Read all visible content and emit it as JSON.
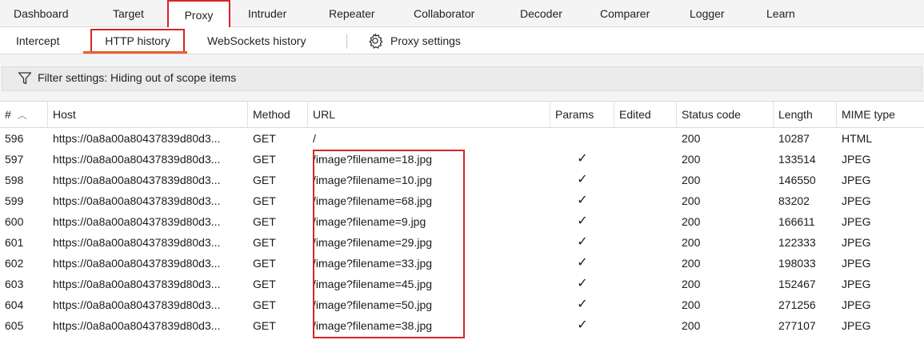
{
  "top_tabs": [
    {
      "label": "Dashboard"
    },
    {
      "label": "Target"
    },
    {
      "label": "Proxy"
    },
    {
      "label": "Intruder"
    },
    {
      "label": "Repeater"
    },
    {
      "label": "Collaborator"
    },
    {
      "label": "Decoder"
    },
    {
      "label": "Comparer"
    },
    {
      "label": "Logger"
    },
    {
      "label": "Learn"
    }
  ],
  "sub_tabs": [
    {
      "label": "Intercept"
    },
    {
      "label": "HTTP history"
    },
    {
      "label": "WebSockets history"
    },
    {
      "label": "Proxy settings"
    }
  ],
  "filter": {
    "label": "Filter settings: Hiding out of scope items"
  },
  "table": {
    "columns": [
      "#",
      "Host",
      "Method",
      "URL",
      "Params",
      "Edited",
      "Status code",
      "Length",
      "MIME type"
    ],
    "sort_indicator": "^",
    "rows": [
      {
        "num": "596",
        "host": "https://0a8a00a80437839d80d3...",
        "method": "GET",
        "url": "/",
        "params": "",
        "edited": "",
        "status": "200",
        "length": "10287",
        "mime": "HTML"
      },
      {
        "num": "597",
        "host": "https://0a8a00a80437839d80d3...",
        "method": "GET",
        "url": "/image?filename=18.jpg",
        "params": "✓",
        "edited": "",
        "status": "200",
        "length": "133514",
        "mime": "JPEG"
      },
      {
        "num": "598",
        "host": "https://0a8a00a80437839d80d3...",
        "method": "GET",
        "url": "/image?filename=10.jpg",
        "params": "✓",
        "edited": "",
        "status": "200",
        "length": "146550",
        "mime": "JPEG"
      },
      {
        "num": "599",
        "host": "https://0a8a00a80437839d80d3...",
        "method": "GET",
        "url": "/image?filename=68.jpg",
        "params": "✓",
        "edited": "",
        "status": "200",
        "length": "83202",
        "mime": "JPEG"
      },
      {
        "num": "600",
        "host": "https://0a8a00a80437839d80d3...",
        "method": "GET",
        "url": "/image?filename=9.jpg",
        "params": "✓",
        "edited": "",
        "status": "200",
        "length": "166611",
        "mime": "JPEG"
      },
      {
        "num": "601",
        "host": "https://0a8a00a80437839d80d3...",
        "method": "GET",
        "url": "/image?filename=29.jpg",
        "params": "✓",
        "edited": "",
        "status": "200",
        "length": "122333",
        "mime": "JPEG"
      },
      {
        "num": "602",
        "host": "https://0a8a00a80437839d80d3...",
        "method": "GET",
        "url": "/image?filename=33.jpg",
        "params": "✓",
        "edited": "",
        "status": "200",
        "length": "198033",
        "mime": "JPEG"
      },
      {
        "num": "603",
        "host": "https://0a8a00a80437839d80d3...",
        "method": "GET",
        "url": "/image?filename=45.jpg",
        "params": "✓",
        "edited": "",
        "status": "200",
        "length": "152467",
        "mime": "JPEG"
      },
      {
        "num": "604",
        "host": "https://0a8a00a80437839d80d3...",
        "method": "GET",
        "url": "/image?filename=50.jpg",
        "params": "✓",
        "edited": "",
        "status": "200",
        "length": "271256",
        "mime": "JPEG"
      },
      {
        "num": "605",
        "host": "https://0a8a00a80437839d80d3...",
        "method": "GET",
        "url": "/image?filename=38.jpg",
        "params": "✓",
        "edited": "",
        "status": "200",
        "length": "277107",
        "mime": "JPEG"
      }
    ]
  },
  "colors": {
    "highlight": "#d8232a",
    "active_underline": "#e8602c"
  },
  "icons": {
    "proxy_settings": "gear-icon",
    "filter": "funnel-icon",
    "params_true": "checkmark-icon"
  }
}
